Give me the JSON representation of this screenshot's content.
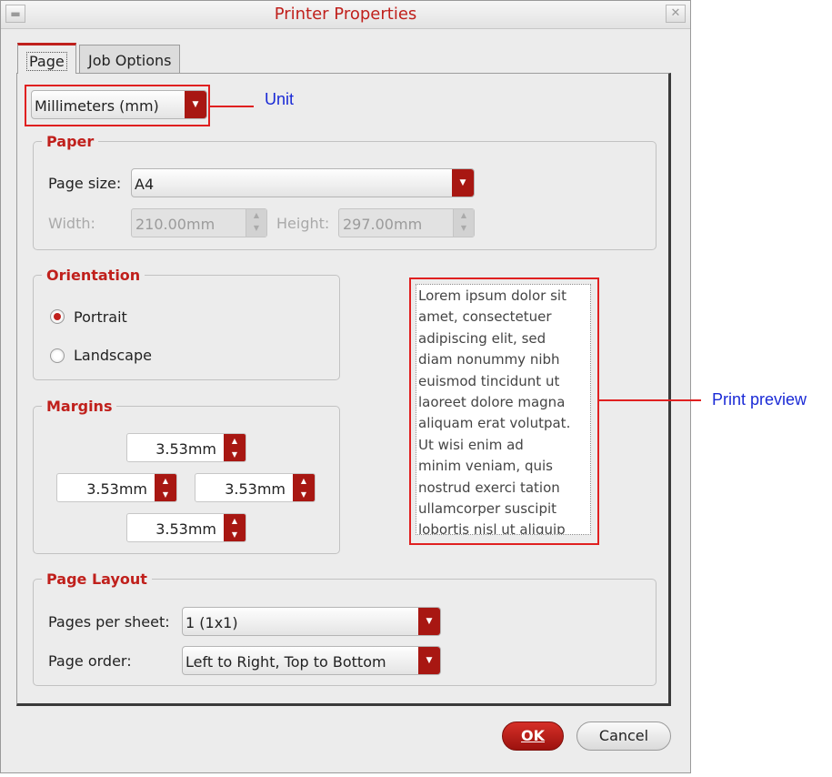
{
  "window": {
    "title": "Printer Properties"
  },
  "tabs": [
    {
      "label": "Page"
    },
    {
      "label": "Job Options"
    }
  ],
  "unit": {
    "value": "Millimeters (mm)"
  },
  "paper": {
    "legend": "Paper",
    "page_size_label": "Page size:",
    "page_size_value": "A4",
    "width_label": "Width:",
    "width_value": "210.00mm",
    "height_label": "Height:",
    "height_value": "297.00mm"
  },
  "orientation": {
    "legend": "Orientation",
    "options": [
      {
        "label": "Portrait",
        "checked": true
      },
      {
        "label": "Landscape",
        "checked": false
      }
    ]
  },
  "margins": {
    "legend": "Margins",
    "top": "3.53mm",
    "left": "3.53mm",
    "right": "3.53mm",
    "bottom": "3.53mm"
  },
  "preview": {
    "lines": [
      "Lorem ipsum dolor sit",
      "amet, consectetuer",
      "adipiscing elit, sed",
      "diam nonummy nibh",
      "euismod tincidunt ut",
      "laoreet dolore magna",
      "aliquam erat volutpat.",
      "Ut wisi enim ad",
      "minim veniam, quis",
      "nostrud exerci tation",
      "ullamcorper suscipit",
      "lobortis nisl ut aliquip"
    ]
  },
  "page_layout": {
    "legend": "Page Layout",
    "pages_per_sheet_label": "Pages per sheet:",
    "pages_per_sheet_value": "1 (1x1)",
    "page_order_label": "Page order:",
    "page_order_value": "Left to Right, Top to Bottom"
  },
  "buttons": {
    "ok": "OK",
    "cancel": "Cancel"
  },
  "annotations": {
    "unit": "Unit",
    "print_preview": "Print preview"
  },
  "colors": {
    "accent": "#c0201c",
    "annotation_box": "#e02020",
    "annotation_text": "#1a2ad6"
  }
}
